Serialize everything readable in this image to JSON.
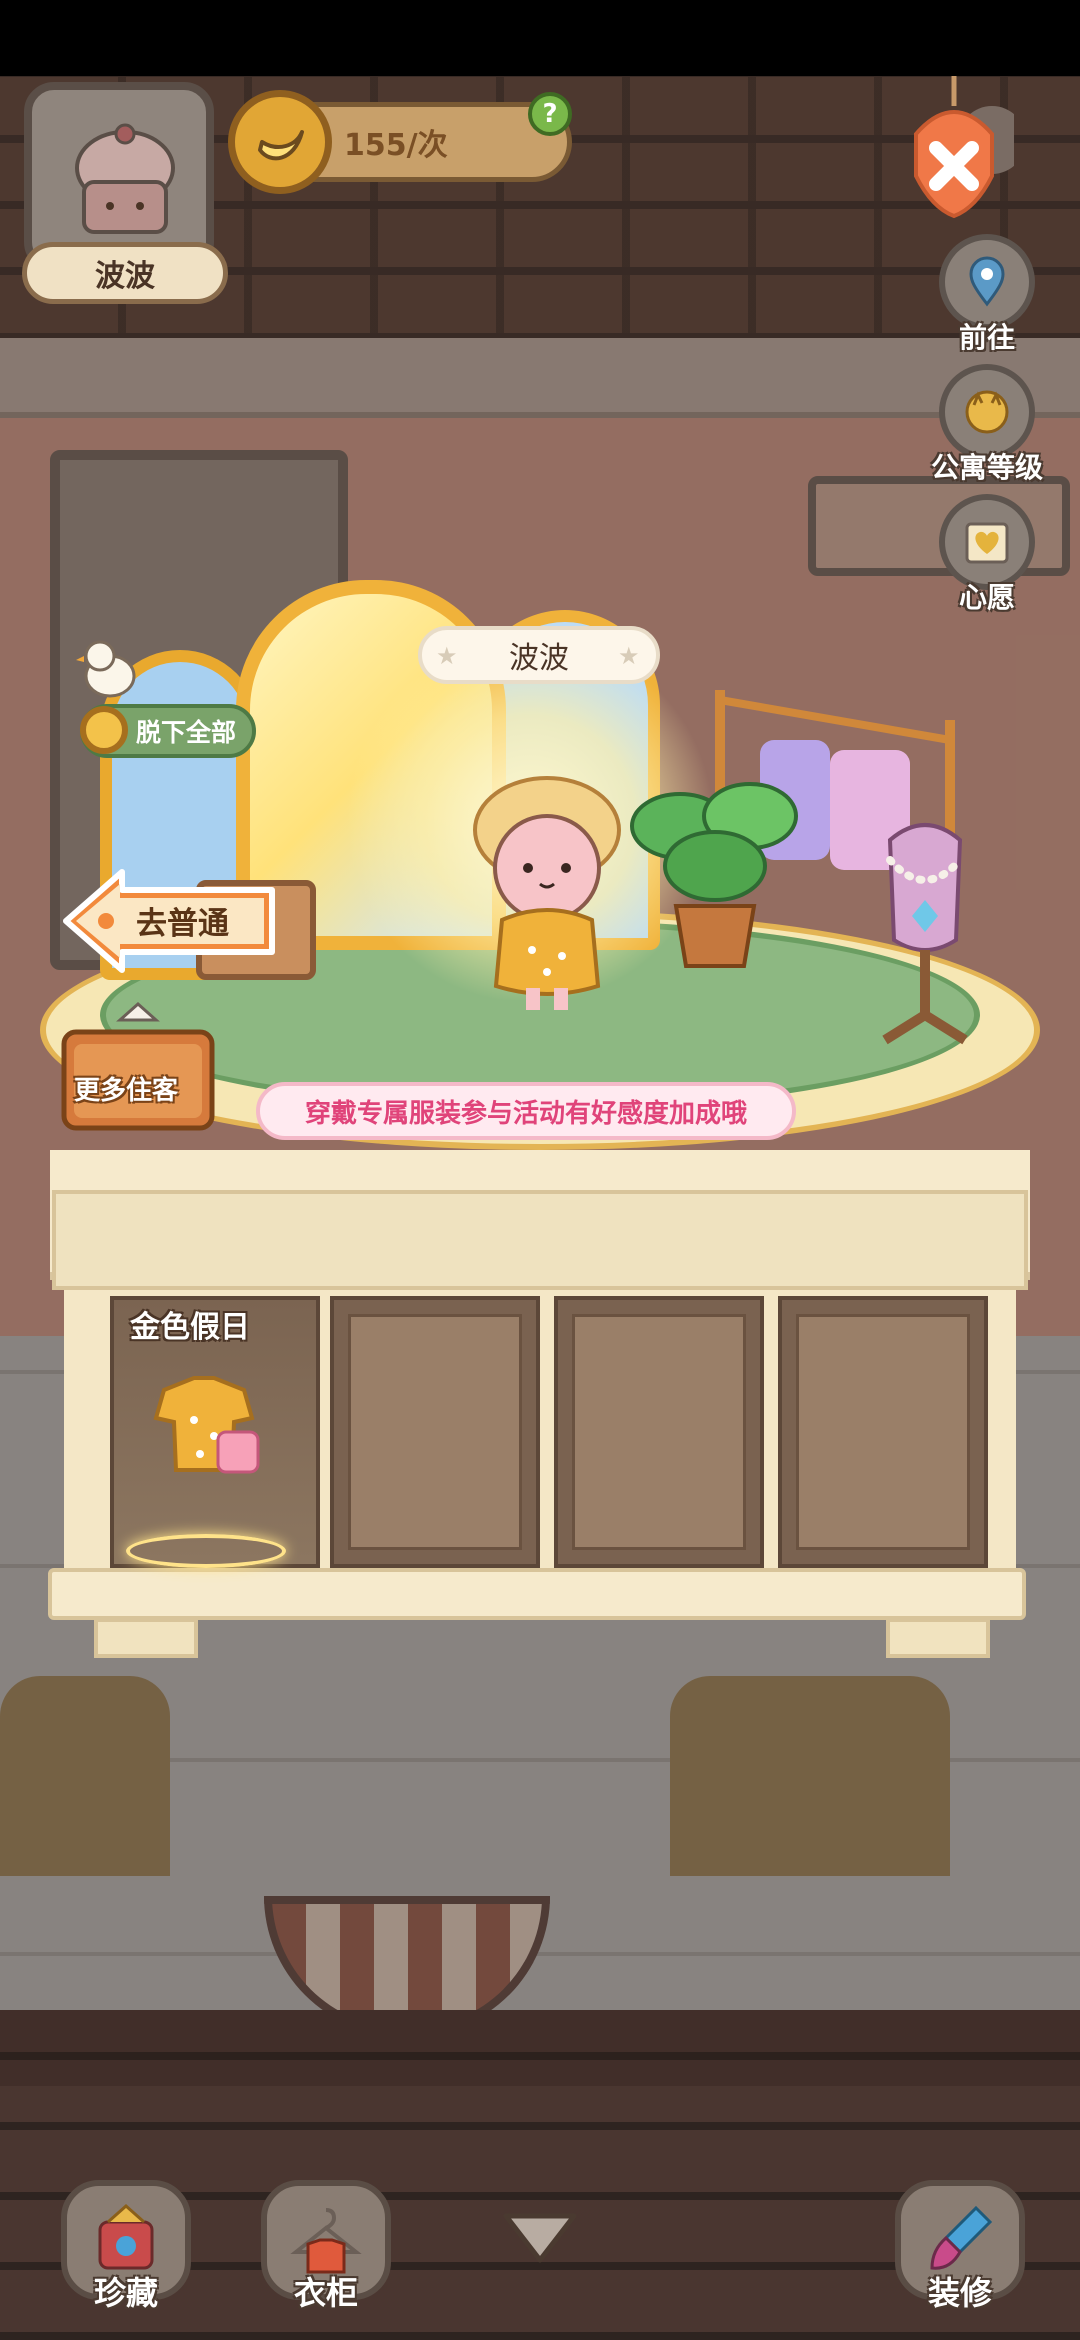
{
  "header": {
    "character_name": "波波",
    "banana_count": "155/次",
    "help_label": "?"
  },
  "right_menu": [
    {
      "label": "前往",
      "icon": "map-pin-icon"
    },
    {
      "label": "公寓等级",
      "icon": "cat-sun-icon"
    },
    {
      "label": "心愿",
      "icon": "heart-book-icon"
    }
  ],
  "stage": {
    "character_name": "波波",
    "undress_all_label": "脱下全部",
    "goto_normal_label": "去普通",
    "more_guests_label": "更多住客",
    "tip": "穿戴专属服装参与活动有好感度加成哦"
  },
  "outfits": {
    "selected_label": "金色假日"
  },
  "bottom_nav": [
    {
      "label": "珍藏",
      "icon": "collection-icon"
    },
    {
      "label": "衣柜",
      "icon": "wardrobe-icon"
    },
    {
      "label": "装修",
      "icon": "paintbrush-icon"
    }
  ],
  "colors": {
    "accent_orange": "#f28a3c",
    "tip_pink": "#e0447a",
    "gold": "#f0b23a"
  }
}
